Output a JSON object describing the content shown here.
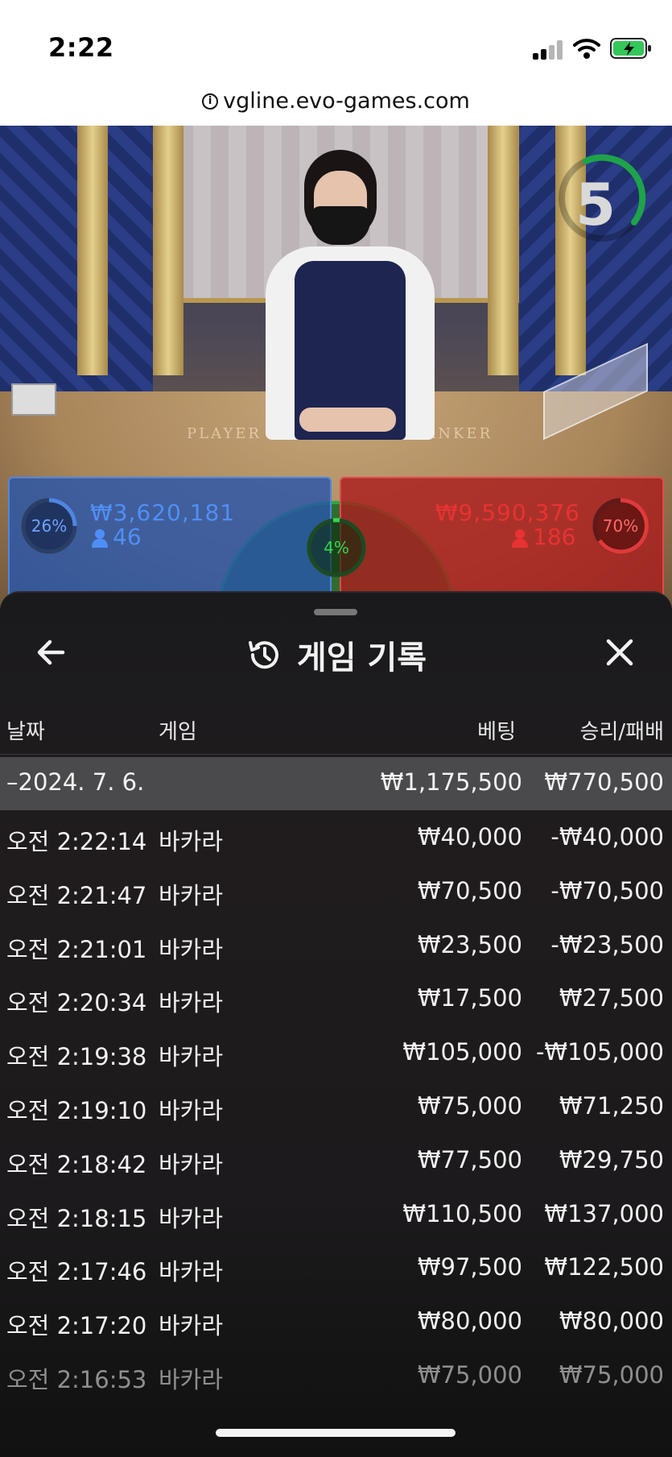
{
  "status_bar": {
    "time": "2:22"
  },
  "browser": {
    "url": "vgline.evo-games.com"
  },
  "game": {
    "timer": "5",
    "player": {
      "percent": "26%",
      "amount": "₩3,620,181",
      "count": "46"
    },
    "banker": {
      "percent": "70%",
      "amount": "₩9,590,376",
      "count": "186"
    },
    "tie": {
      "percent": "4%"
    },
    "felt_labels": {
      "player": "PLAYER",
      "banker": "BANKER"
    }
  },
  "history": {
    "title": "게임 기록",
    "columns": {
      "date": "날짜",
      "game": "게임",
      "bet": "베팅",
      "win_loss": "승리/패배"
    },
    "day": {
      "date": "–2024. 7. 6.",
      "bet": "₩1,175,500",
      "result": "₩770,500"
    },
    "rows": [
      {
        "time": "오전 2:22:14",
        "game": "바카라",
        "bet": "₩40,000",
        "result": "-₩40,000"
      },
      {
        "time": "오전 2:21:47",
        "game": "바카라",
        "bet": "₩70,500",
        "result": "-₩70,500"
      },
      {
        "time": "오전 2:21:01",
        "game": "바카라",
        "bet": "₩23,500",
        "result": "-₩23,500"
      },
      {
        "time": "오전 2:20:34",
        "game": "바카라",
        "bet": "₩17,500",
        "result": "₩27,500"
      },
      {
        "time": "오전 2:19:38",
        "game": "바카라",
        "bet": "₩105,000",
        "result": "-₩105,000"
      },
      {
        "time": "오전 2:19:10",
        "game": "바카라",
        "bet": "₩75,000",
        "result": "₩71,250"
      },
      {
        "time": "오전 2:18:42",
        "game": "바카라",
        "bet": "₩77,500",
        "result": "₩29,750"
      },
      {
        "time": "오전 2:18:15",
        "game": "바카라",
        "bet": "₩110,500",
        "result": "₩137,000"
      },
      {
        "time": "오전 2:17:46",
        "game": "바카라",
        "bet": "₩97,500",
        "result": "₩122,500"
      },
      {
        "time": "오전 2:17:20",
        "game": "바카라",
        "bet": "₩80,000",
        "result": "₩80,000"
      },
      {
        "time": "오전 2:16:53",
        "game": "바카라",
        "bet": "₩75,000",
        "result": "₩75,000"
      }
    ]
  },
  "icons": {
    "back": "arrow-left-icon",
    "close": "close-icon",
    "history": "history-icon",
    "user": "user-icon"
  },
  "colors": {
    "player": "#4f86e0",
    "banker": "#e04a4a",
    "tie": "#36d552",
    "timer_ring": "#1fa34a"
  }
}
